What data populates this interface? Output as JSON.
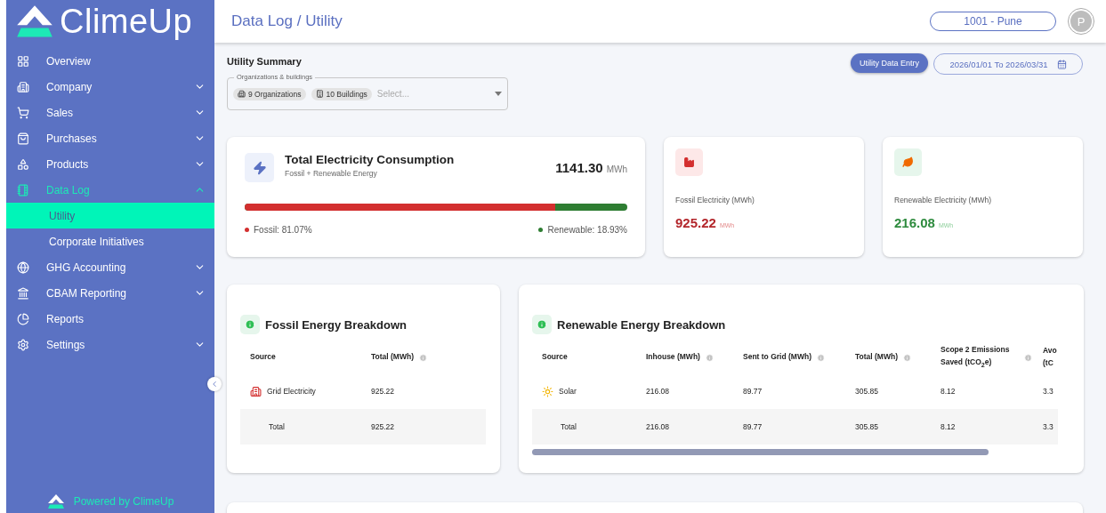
{
  "sidebar": {
    "logo": "ClimeUp",
    "items": [
      {
        "label": "Overview",
        "kind": "link",
        "selected": false
      },
      {
        "label": "Company",
        "kind": "group",
        "expanded": false,
        "selected": false
      },
      {
        "label": "Sales",
        "kind": "group",
        "expanded": false,
        "selected": false
      },
      {
        "label": "Purchases",
        "kind": "group",
        "expanded": false,
        "selected": false
      },
      {
        "label": "Products",
        "kind": "group",
        "expanded": false,
        "selected": false
      },
      {
        "label": "Data Log",
        "kind": "group",
        "expanded": true,
        "selected": true,
        "children": [
          {
            "label": "Utility",
            "selected": true
          },
          {
            "label": "Corporate Initiatives",
            "selected": false
          }
        ]
      },
      {
        "label": "GHG Accounting",
        "kind": "group",
        "expanded": false,
        "selected": false
      },
      {
        "label": "CBAM Reporting",
        "kind": "group",
        "expanded": false,
        "selected": false
      },
      {
        "label": "Reports",
        "kind": "link",
        "selected": false
      },
      {
        "label": "Settings",
        "kind": "group",
        "expanded": false,
        "selected": false
      }
    ],
    "footer": "Powered by ClimeUp"
  },
  "header": {
    "title": "Data Log / Utility",
    "location": "1001 - Pune",
    "avatar": "P"
  },
  "summary": {
    "title": "Utility Summary",
    "filter": {
      "label": "Organizations & buildings",
      "chips": [
        "9 Organizations",
        "10 Buildings"
      ],
      "placeholder": "Select..."
    },
    "entry_button": "Utility Data Entry",
    "date_range": "2026/01/01 To 2026/03/31"
  },
  "total_card": {
    "title": "Total Electricity Consumption",
    "subtitle": "Fossil + Renewable Energy",
    "value": "1141.30",
    "unit": "MWh",
    "bar": {
      "level": 0.8107
    },
    "legend": [
      {
        "label": "Fossil: 81.07%",
        "color": "#d32f2f"
      },
      {
        "label": "Renewable: 18.93%",
        "color": "#2e7d32"
      }
    ]
  },
  "stat_cards": [
    {
      "kind": "fossil",
      "label": "Fossil Electricity (MWh)",
      "value": "925.22",
      "unit": "MWh"
    },
    {
      "kind": "renewable",
      "label": "Renewable Electricity (MWh)",
      "value": "216.08",
      "unit": "MWh"
    }
  ],
  "breakdowns": [
    {
      "title": "Fossil Energy Breakdown",
      "columns": [
        {
          "label": "Source",
          "info": false
        },
        {
          "label": "Total (MWh)",
          "info": true
        }
      ],
      "rows": [
        {
          "kind": "source",
          "cells": [
            "Grid Electricity",
            "925.22"
          ]
        },
        {
          "kind": "total",
          "cells": [
            "Total",
            "925.22"
          ]
        }
      ]
    },
    {
      "title": "Renewable Energy Breakdown",
      "columns": [
        {
          "label": "Source",
          "info": false
        },
        {
          "label": "Inhouse (MWh)",
          "info": true
        },
        {
          "label": "Sent to Grid (MWh)",
          "info": true
        },
        {
          "label": "Total (MWh)",
          "info": true
        },
        {
          "label": "Scope 2 Emissions Saved (tCO$_{2}$e)",
          "info": true
        },
        {
          "label": "Avo (tC",
          "info": false
        }
      ],
      "rows": [
        {
          "kind": "source",
          "cells": [
            "Solar",
            "216.08",
            "89.77",
            "305.85",
            "8.12",
            "3.3"
          ]
        },
        {
          "kind": "total",
          "cells": [
            "Total",
            "216.08",
            "89.77",
            "305.85",
            "8.12",
            "3.3"
          ]
        }
      ]
    }
  ]
}
